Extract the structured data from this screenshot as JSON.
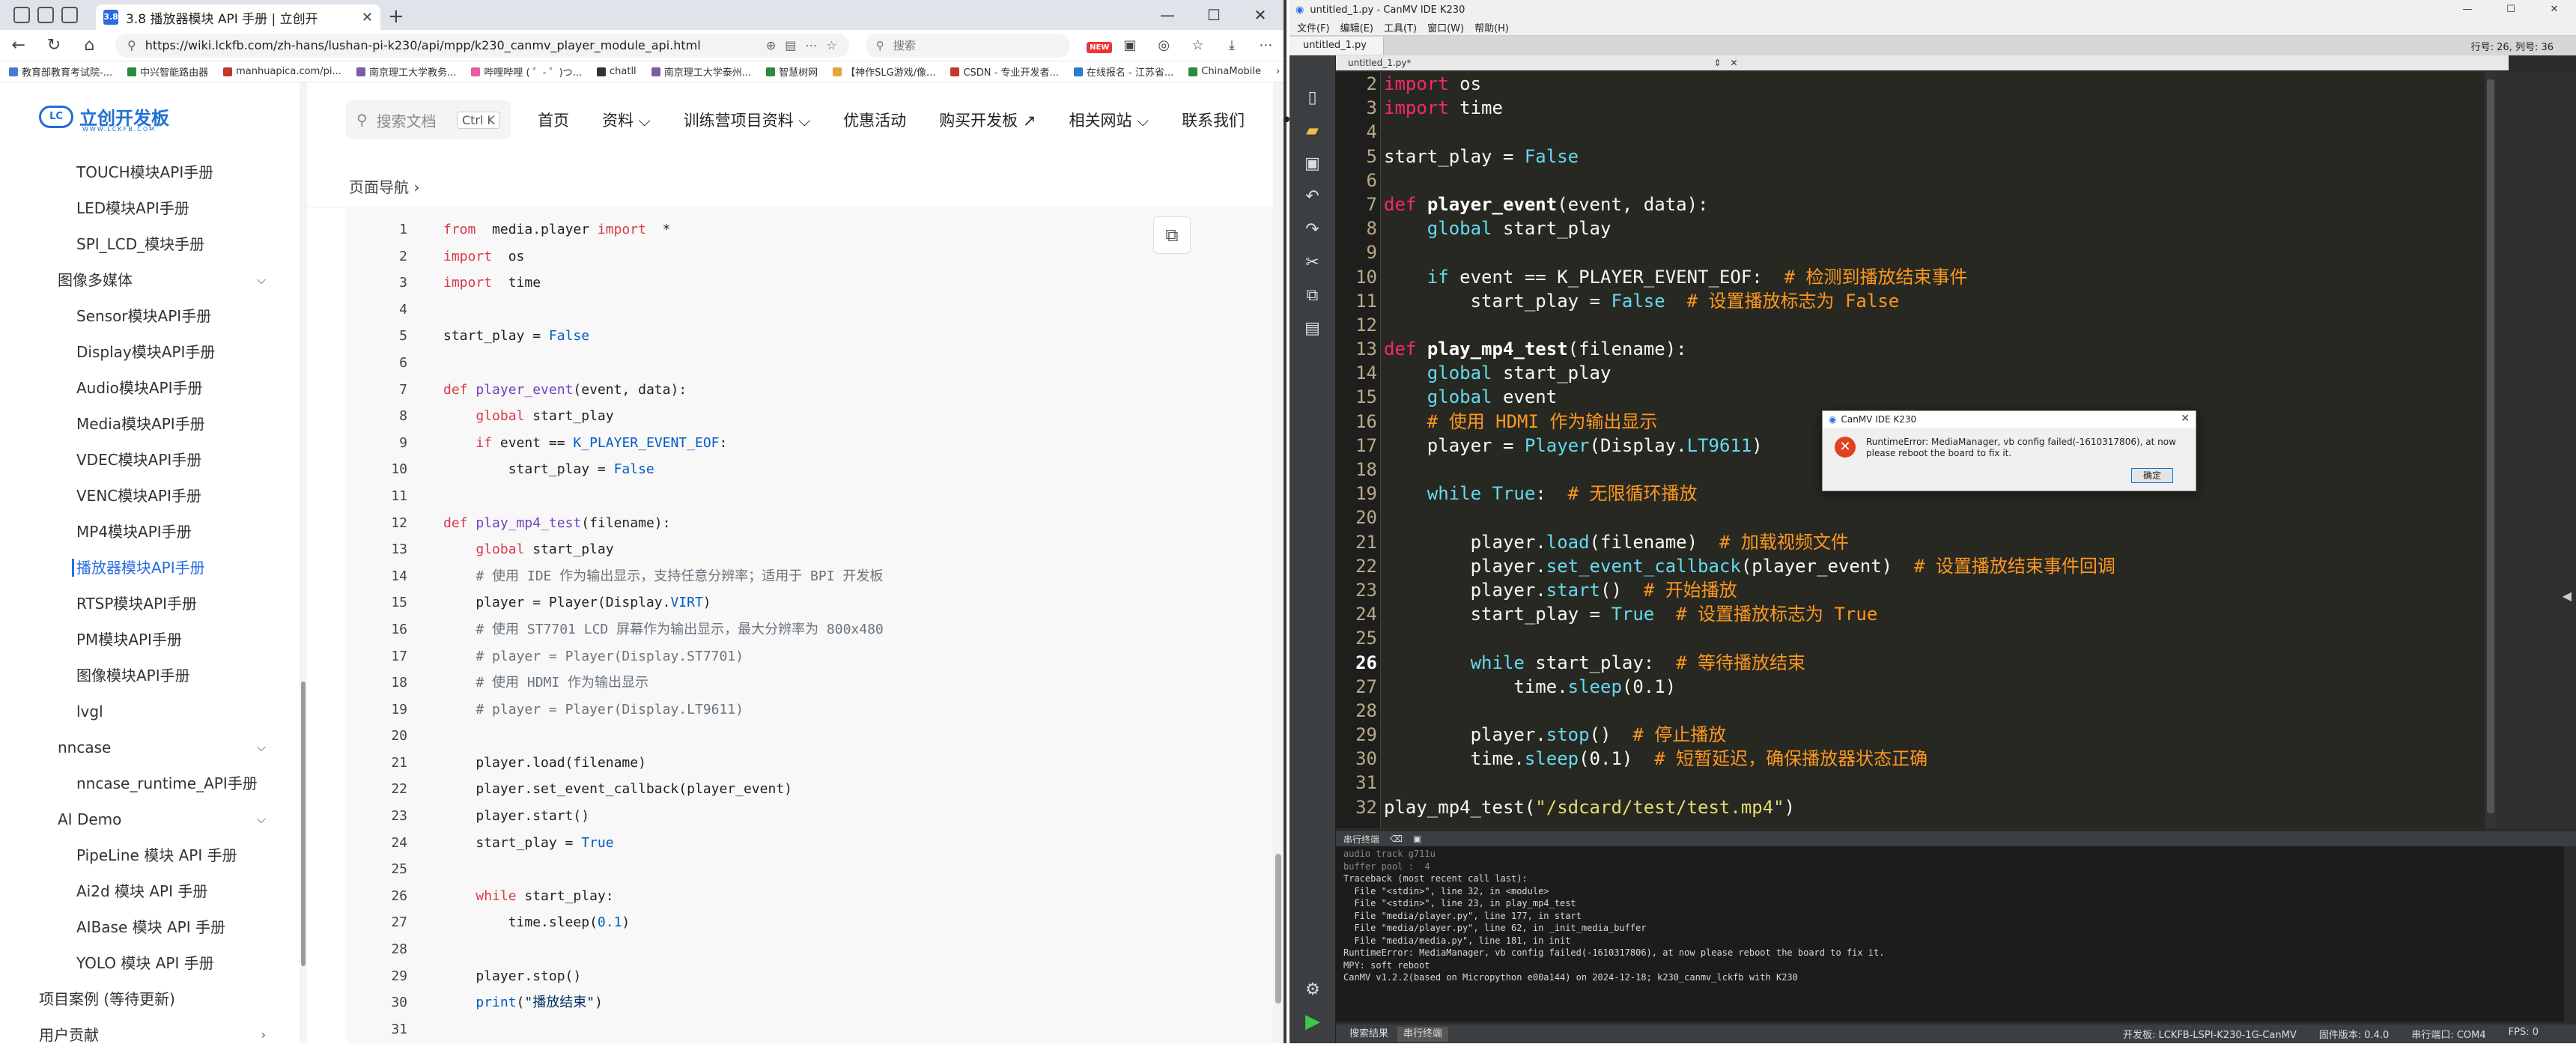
{
  "browser": {
    "tab_title": "3.8 播放器模块 API 手册 | 立创开",
    "tab_favicon": "3.8",
    "url": "https://wiki.lckfb.com/zh-hans/lushan-pi-k230/api/mpp/k230_canmv_player_module_api.html",
    "search_placeholder": "搜索",
    "bookmarks": [
      "教育部教育考试院-...",
      "中兴智能路由器",
      "manhuapica.com/pi...",
      "南京理工大学教务...",
      "哔哩哔哩 ( ゜- ゜)つ...",
      "chatll",
      "南京理工大学泰州...",
      "智慧树网",
      "【神作SLG游戏/像...",
      "CSDN - 专业开发者...",
      "在线报名 - 江苏省...",
      "ChinaMobile"
    ],
    "bookmark_colors": [
      "#4a7bd1",
      "#2b8a3e",
      "#c0392b",
      "#7d5ba6",
      "#e85d9f",
      "#333333",
      "#7d5ba6",
      "#2b8a3e",
      "#e8a33d",
      "#c0392b",
      "#2b7bd1",
      "#2b8a3e"
    ]
  },
  "site": {
    "logo_text": "立创开发板",
    "logo_mark": "LC",
    "logo_sub": "WWW.LCKFB.COM",
    "search_label": "搜索文档",
    "search_kbd": "Ctrl K",
    "nav": [
      "首页",
      "资料",
      "训练营项目资料",
      "优惠活动",
      "购买开发板 ↗",
      "相关网站",
      "联系我们"
    ],
    "breadcrumb": "页面导航",
    "sidebar": [
      {
        "label": "TOUCH模块API手册",
        "level": "item"
      },
      {
        "label": "LED模块API手册",
        "level": "item"
      },
      {
        "label": "SPI_LCD_模块手册",
        "level": "item"
      },
      {
        "label": "图像多媒体",
        "level": "group"
      },
      {
        "label": "Sensor模块API手册",
        "level": "item"
      },
      {
        "label": "Display模块API手册",
        "level": "item"
      },
      {
        "label": "Audio模块API手册",
        "level": "item"
      },
      {
        "label": "Media模块API手册",
        "level": "item"
      },
      {
        "label": "VDEC模块API手册",
        "level": "item"
      },
      {
        "label": "VENC模块API手册",
        "level": "item"
      },
      {
        "label": "MP4模块API手册",
        "level": "item"
      },
      {
        "label": "播放器模块API手册",
        "level": "active"
      },
      {
        "label": "RTSP模块API手册",
        "level": "item"
      },
      {
        "label": "PM模块API手册",
        "level": "item"
      },
      {
        "label": "图像模块API手册",
        "level": "item"
      },
      {
        "label": "lvgl",
        "level": "item"
      },
      {
        "label": "nncase",
        "level": "group"
      },
      {
        "label": "nncase_runtime_API手册",
        "level": "item"
      },
      {
        "label": "AI Demo",
        "level": "group"
      },
      {
        "label": "PipeLine 模块 API 手册",
        "level": "item"
      },
      {
        "label": "Ai2d 模块 API 手册",
        "level": "item"
      },
      {
        "label": "AIBase 模块 API 手册",
        "level": "item"
      },
      {
        "label": "YOLO 模块 API 手册",
        "level": "item"
      },
      {
        "label": "项目案例 (等待更新)",
        "level": "top"
      },
      {
        "label": "用户贡献",
        "level": "top"
      }
    ],
    "code_lines": [
      [
        [
          "kw",
          "from"
        ],
        [
          "",
          "  media.player "
        ],
        [
          "kw",
          "import"
        ],
        [
          "",
          "  *"
        ]
      ],
      [
        [
          "kw",
          "import"
        ],
        [
          "",
          "  os"
        ]
      ],
      [
        [
          "kw",
          "import"
        ],
        [
          "",
          "  time"
        ]
      ],
      [
        [
          "",
          ""
        ]
      ],
      [
        [
          "",
          "start_play = "
        ],
        [
          "bl",
          "False"
        ]
      ],
      [
        [
          "",
          ""
        ]
      ],
      [
        [
          "kw",
          "def"
        ],
        [
          "",
          " "
        ],
        [
          "fn",
          "player_event"
        ],
        [
          "",
          "(event, data):"
        ]
      ],
      [
        [
          "",
          "    "
        ],
        [
          "kw",
          "global"
        ],
        [
          "",
          " start_play"
        ]
      ],
      [
        [
          "",
          "    "
        ],
        [
          "kw",
          "if"
        ],
        [
          "",
          " event == "
        ],
        [
          "bl",
          "K_PLAYER_EVENT_EOF"
        ],
        [
          "",
          ":"
        ]
      ],
      [
        [
          "",
          "        start_play = "
        ],
        [
          "bl",
          "False"
        ]
      ],
      [
        [
          "",
          ""
        ]
      ],
      [
        [
          "kw",
          "def"
        ],
        [
          "",
          " "
        ],
        [
          "fn",
          "play_mp4_test"
        ],
        [
          "",
          "(filename):"
        ]
      ],
      [
        [
          "",
          "    "
        ],
        [
          "kw",
          "global"
        ],
        [
          "",
          " start_play"
        ]
      ],
      [
        [
          "",
          "    "
        ],
        [
          "cm",
          "# 使用 IDE 作为输出显示，支持任意分辨率；适用于 BPI 开发板"
        ]
      ],
      [
        [
          "",
          "    player = Player(Display."
        ],
        [
          "bl",
          "VIRT"
        ],
        [
          "",
          ")"
        ]
      ],
      [
        [
          "",
          "    "
        ],
        [
          "cm",
          "# 使用 ST7701 LCD 屏幕作为输出显示，最大分辨率为 800x480"
        ]
      ],
      [
        [
          "",
          "    "
        ],
        [
          "cm",
          "# player = Player(Display.ST7701)"
        ]
      ],
      [
        [
          "",
          "    "
        ],
        [
          "cm",
          "# 使用 HDMI 作为输出显示"
        ]
      ],
      [
        [
          "",
          "    "
        ],
        [
          "cm",
          "# player = Player(Display.LT9611)"
        ]
      ],
      [
        [
          "",
          ""
        ]
      ],
      [
        [
          "",
          "    player.load(filename)"
        ]
      ],
      [
        [
          "",
          "    player.set_event_callback(player_event)"
        ]
      ],
      [
        [
          "",
          "    player.start()"
        ]
      ],
      [
        [
          "",
          "    start_play = "
        ],
        [
          "bl",
          "True"
        ]
      ],
      [
        [
          "",
          ""
        ]
      ],
      [
        [
          "",
          "    "
        ],
        [
          "kw",
          "while"
        ],
        [
          "",
          " start_play:"
        ]
      ],
      [
        [
          "",
          "        time.sleep("
        ],
        [
          "bl",
          "0.1"
        ],
        [
          "",
          ")"
        ]
      ],
      [
        [
          "",
          ""
        ]
      ],
      [
        [
          "",
          "    player.stop()"
        ]
      ],
      [
        [
          "",
          "    "
        ],
        [
          "bl",
          "print"
        ],
        [
          "",
          "("
        ],
        [
          "st",
          "\"播放结束\""
        ],
        [
          "",
          ")"
        ]
      ],
      [
        [
          "",
          ""
        ]
      ]
    ]
  },
  "ide": {
    "window_title": "untitled_1.py - CanMV IDE K230",
    "menu": [
      "文件(F)",
      "编辑(E)",
      "工具(T)",
      "窗口(W)",
      "帮助(H)"
    ],
    "file_tab": "untitled_1.py",
    "subtab": "untitled_1.py*",
    "cursor_pos": "行号: 26, 列号: 36",
    "current_line": 26,
    "first_line_number": 2,
    "editor_lines": [
      [
        [
          "iw",
          "import"
        ],
        [
          "",
          " os"
        ]
      ],
      [
        [
          "iw",
          "import"
        ],
        [
          "",
          " time"
        ]
      ],
      [
        [
          "",
          ""
        ]
      ],
      [
        [
          "",
          "start_play = "
        ],
        [
          "ib",
          "False"
        ]
      ],
      [
        [
          "",
          ""
        ]
      ],
      [
        [
          "iw",
          "def"
        ],
        [
          "",
          " "
        ],
        [
          "if",
          "player_event"
        ],
        [
          "",
          "(event, data):"
        ]
      ],
      [
        [
          "",
          "    "
        ],
        [
          "ik",
          "global"
        ],
        [
          "",
          " start_play"
        ]
      ],
      [
        [
          "",
          ""
        ]
      ],
      [
        [
          "",
          "    "
        ],
        [
          "ik",
          "if"
        ],
        [
          "",
          " event == K_PLAYER_EVENT_EOF:  "
        ],
        [
          "ic",
          "# 检测到播放结束事件"
        ]
      ],
      [
        [
          "",
          "        start_play = "
        ],
        [
          "ib",
          "False"
        ],
        [
          "",
          "  "
        ],
        [
          "ic",
          "# 设置播放标志为 False"
        ]
      ],
      [
        [
          "",
          ""
        ]
      ],
      [
        [
          "iw",
          "def"
        ],
        [
          "",
          " "
        ],
        [
          "if",
          "play_mp4_test"
        ],
        [
          "",
          "(filename):"
        ]
      ],
      [
        [
          "",
          "    "
        ],
        [
          "ik",
          "global"
        ],
        [
          "",
          " start_play"
        ]
      ],
      [
        [
          "",
          "    "
        ],
        [
          "ik",
          "global"
        ],
        [
          "",
          " event"
        ]
      ],
      [
        [
          "",
          "    "
        ],
        [
          "ic",
          "# 使用 HDMI 作为输出显示"
        ]
      ],
      [
        [
          "",
          "    player = "
        ],
        [
          "in",
          "Player"
        ],
        [
          "",
          "(Display."
        ],
        [
          "in",
          "LT9611"
        ],
        [
          "",
          ")"
        ]
      ],
      [
        [
          "",
          ""
        ]
      ],
      [
        [
          "",
          "    "
        ],
        [
          "ik",
          "while"
        ],
        [
          "",
          " "
        ],
        [
          "ib",
          "True"
        ],
        [
          "",
          ":  "
        ],
        [
          "ic",
          "# 无限循环播放"
        ]
      ],
      [
        [
          "",
          ""
        ]
      ],
      [
        [
          "",
          "        player."
        ],
        [
          "in",
          "load"
        ],
        [
          "",
          "(filename)  "
        ],
        [
          "ic",
          "# 加载视频文件"
        ]
      ],
      [
        [
          "",
          "        player."
        ],
        [
          "in",
          "set_event_callback"
        ],
        [
          "",
          "(player_event)  "
        ],
        [
          "ic",
          "# 设置播放结束事件回调"
        ]
      ],
      [
        [
          "",
          "        player."
        ],
        [
          "in",
          "start"
        ],
        [
          "",
          "()  "
        ],
        [
          "ic",
          "# 开始播放"
        ]
      ],
      [
        [
          "",
          "        start_play = "
        ],
        [
          "ib",
          "True"
        ],
        [
          "",
          "  "
        ],
        [
          "ic",
          "# 设置播放标志为 True"
        ]
      ],
      [
        [
          "",
          ""
        ]
      ],
      [
        [
          "",
          "        "
        ],
        [
          "ik",
          "while"
        ],
        [
          "",
          " start_play:  "
        ],
        [
          "ic",
          "# 等待播放结束"
        ]
      ],
      [
        [
          "",
          "            time."
        ],
        [
          "in",
          "sleep"
        ],
        [
          "",
          "(0.1)"
        ]
      ],
      [
        [
          "",
          ""
        ]
      ],
      [
        [
          "",
          "        player."
        ],
        [
          "in",
          "stop"
        ],
        [
          "",
          "()  "
        ],
        [
          "ic",
          "# 停止播放"
        ]
      ],
      [
        [
          "",
          "        time."
        ],
        [
          "in",
          "sleep"
        ],
        [
          "",
          "(0.1)  "
        ],
        [
          "ic",
          "# 短暂延迟，确保播放器状态正确"
        ]
      ],
      [
        [
          "",
          ""
        ]
      ],
      [
        [
          "",
          "play_mp4_test("
        ],
        [
          "is",
          "\"/sdcard/test/test.mp4\""
        ],
        [
          "",
          ")"
        ]
      ]
    ],
    "terminal_header": "串行终端",
    "terminal_lines": [
      {
        "t": "audio track g711u",
        "dim": true
      },
      {
        "t": "buffer pool :  4",
        "dim": true
      },
      {
        "t": "",
        "dim": false
      },
      {
        "t": "Traceback (most recent call last):",
        "dim": false
      },
      {
        "t": "  File \"<stdin>\", line 32, in <module>",
        "dim": false
      },
      {
        "t": "  File \"<stdin>\", line 23, in play_mp4_test",
        "dim": false
      },
      {
        "t": "  File \"media/player.py\", line 177, in start",
        "dim": false
      },
      {
        "t": "  File \"media/player.py\", line 62, in _init_media_buffer",
        "dim": false
      },
      {
        "t": "  File \"media/media.py\", line 181, in init",
        "dim": false
      },
      {
        "t": "RuntimeError: MediaManager, vb config failed(-1610317806), at now please reboot the board to fix it.",
        "dim": false
      },
      {
        "t": "MPY: soft reboot",
        "dim": false
      },
      {
        "t": "CanMV v1.2.2(based on Micropython e00a144) on 2024-12-18; k230_canmv_lckfb with K230",
        "dim": false
      }
    ],
    "status_tabs": [
      "搜索结果",
      "串行终端"
    ],
    "status_board": "开发板: LCKFB-LSPI-K230-1G-CanMV",
    "status_firmware": "固件版本: 0.4.0",
    "status_port": "串行端口: COM4",
    "status_fps": "FPS: 0",
    "dialog": {
      "title": "CanMV IDE K230",
      "message": "RuntimeError: MediaManager, vb config failed(-1610317806), at now please reboot the board to fix it.",
      "ok": "确定"
    }
  }
}
